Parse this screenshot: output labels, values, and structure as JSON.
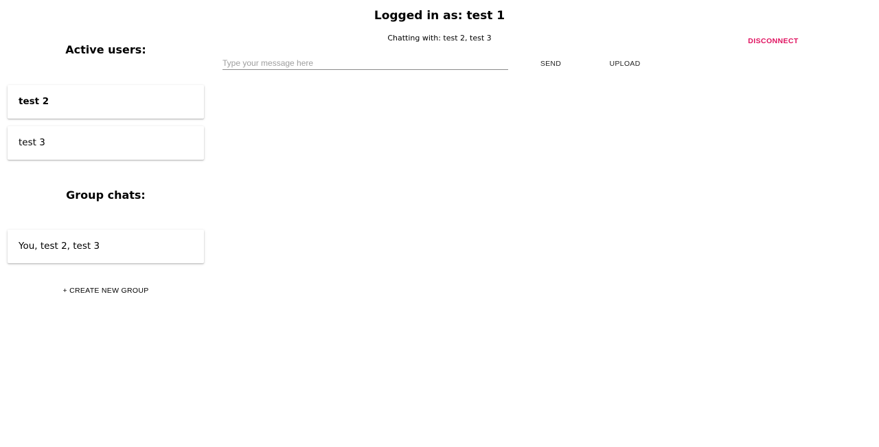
{
  "header": {
    "title": "Logged in as: test 1",
    "subtitle": "Chatting with: test 2, test 3",
    "disconnect_label": "DISCONNECT"
  },
  "sidebar": {
    "active_users_heading": "Active users:",
    "active_users": [
      {
        "label": "test 2",
        "selected": true
      },
      {
        "label": "test 3",
        "selected": false
      }
    ],
    "group_chats_heading": "Group chats:",
    "group_chats": [
      {
        "label": "You, test 2, test 3"
      }
    ],
    "create_group_label": "+ CREATE NEW GROUP"
  },
  "composer": {
    "message_placeholder": "Type your message here",
    "message_value": "",
    "send_label": "SEND",
    "upload_label": "UPLOAD"
  },
  "colors": {
    "accent": "#e0115f"
  }
}
